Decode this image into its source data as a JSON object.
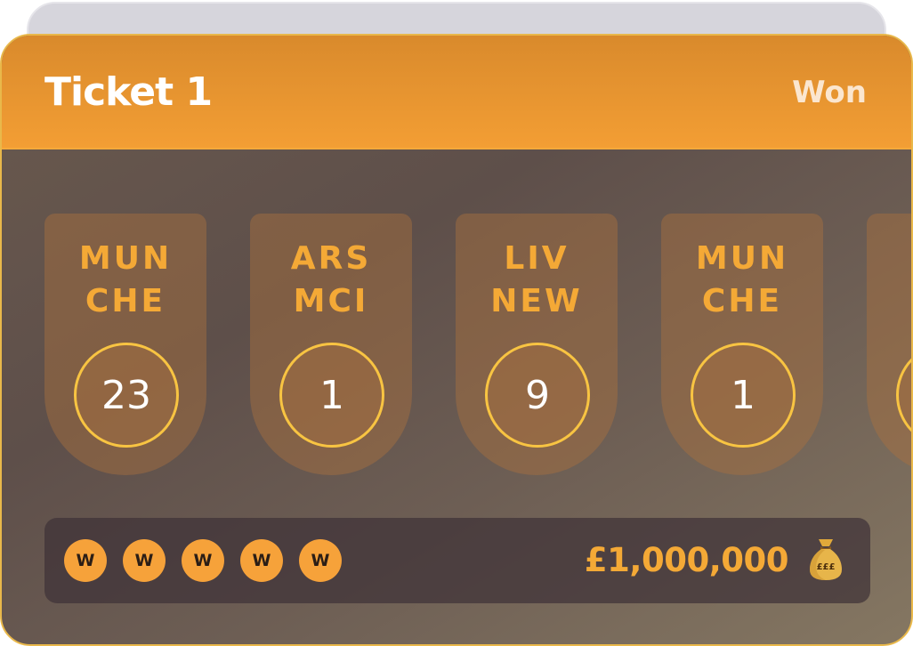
{
  "ticket": {
    "title": "Ticket 1",
    "status": "Won"
  },
  "picks": [
    {
      "home": "MUN",
      "away": "CHE",
      "score": "23"
    },
    {
      "home": "ARS",
      "away": "MCI",
      "score": "1"
    },
    {
      "home": "LIV",
      "away": "NEW",
      "score": "9"
    },
    {
      "home": "MUN",
      "away": "CHE",
      "score": "1"
    },
    {
      "home": "",
      "away": "",
      "score": ""
    }
  ],
  "results": {
    "badges": [
      "W",
      "W",
      "W",
      "W",
      "W"
    ]
  },
  "prize": {
    "amount": "£1,000,000",
    "bag_label": "£££",
    "icon": "money-bag-icon"
  },
  "colors": {
    "header_orange": "#f39e34",
    "accent_gold": "#f4a936",
    "ring_yellow": "#f8c442",
    "badge_orange": "#f6a23a"
  }
}
